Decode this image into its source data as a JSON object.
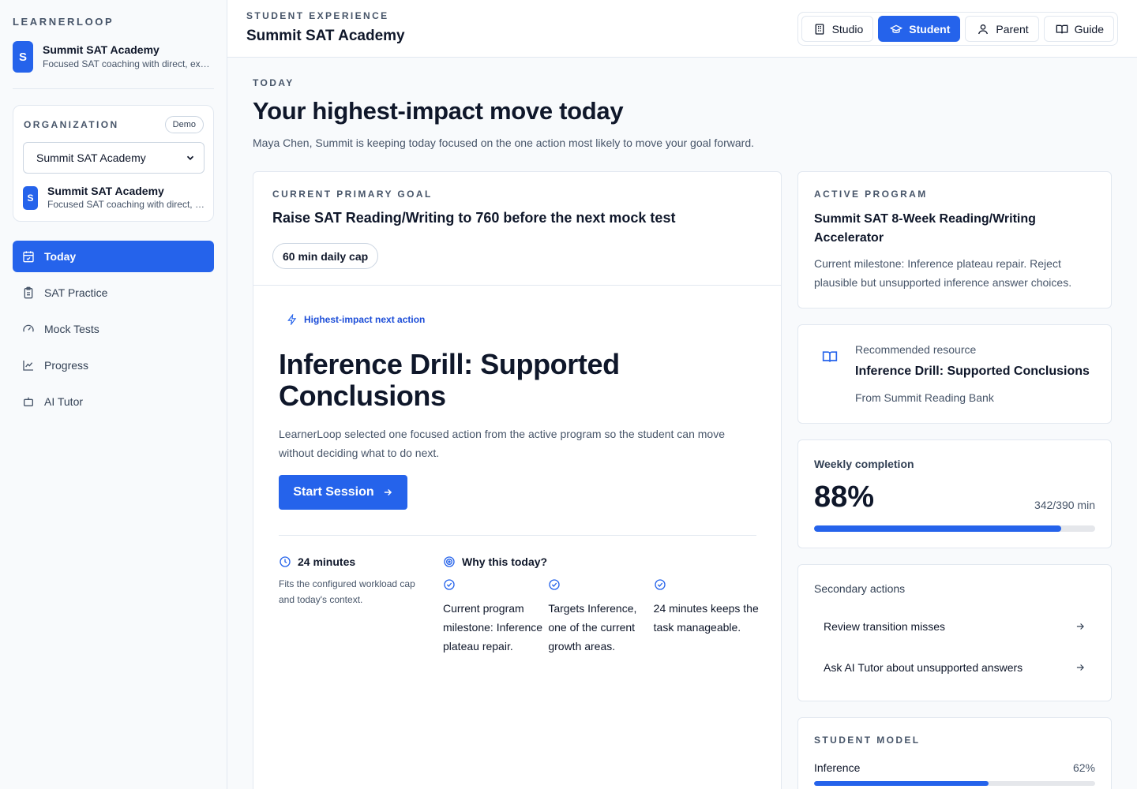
{
  "sidebar": {
    "brand": "LEARNERLOOP",
    "org": {
      "initial": "S",
      "name": "Summit SAT Academy",
      "subtitle": "Focused SAT coaching with direct, exam-specific feedback"
    },
    "org_card": {
      "label": "ORGANIZATION",
      "badge": "Demo",
      "select_value": "Summit SAT Academy",
      "initial": "S",
      "name": "Summit SAT Academy",
      "subtitle": "Focused SAT coaching with direct, exam-specific feedback"
    },
    "nav": [
      {
        "label": "Today",
        "icon": "calendar-icon",
        "active": true
      },
      {
        "label": "SAT Practice",
        "icon": "clipboard-icon"
      },
      {
        "label": "Mock Tests",
        "icon": "gauge-icon"
      },
      {
        "label": "Progress",
        "icon": "chart-line-icon"
      },
      {
        "label": "AI Tutor",
        "icon": "bot-icon"
      }
    ]
  },
  "topbar": {
    "kicker": "STUDENT EXPERIENCE",
    "title": "Summit SAT Academy",
    "modes": [
      {
        "label": "Studio",
        "icon": "building-icon"
      },
      {
        "label": "Student",
        "icon": "graduation-cap-icon",
        "active": true
      },
      {
        "label": "Parent",
        "icon": "user-icon"
      },
      {
        "label": "Guide",
        "icon": "book-open-icon"
      }
    ]
  },
  "main": {
    "kicker": "TODAY",
    "title": "Your highest-impact move today",
    "subtitle": "Maya Chen, Summit is keeping today focused on the one action most likely to move your goal forward.",
    "goal": {
      "label": "CURRENT PRIMARY GOAL",
      "text": "Raise SAT Reading/Writing to 760 before the next mock test",
      "cap": "60 min daily cap"
    },
    "action": {
      "tag": "Highest-impact next action",
      "title": "Inference Drill: Supported Conclusions",
      "description": "LearnerLoop selected one focused action from the active program so the student can move without deciding what to do next.",
      "button": "Start Session",
      "duration": "24 minutes",
      "duration_note": "Fits the configured workload cap and today's context.",
      "why_title": "Why this today?",
      "reasons": [
        "Current program milestone: Inference plateau repair.",
        "Targets Inference, one of the current growth areas.",
        "24 minutes keeps the task manageable."
      ]
    },
    "program": {
      "label": "ACTIVE PROGRAM",
      "title": "Summit SAT 8-Week Reading/Writing Accelerator",
      "description": "Current milestone: Inference plateau repair. Reject plausible but unsupported inference answer choices."
    },
    "resource": {
      "label": "Recommended resource",
      "title": "Inference Drill: Supported Conclusions",
      "from": "From Summit Reading Bank"
    },
    "weekly": {
      "label": "Weekly completion",
      "percent_text": "88%",
      "minutes": "342/390 min",
      "progress": 0.88
    },
    "secondary": {
      "label": "Secondary actions",
      "items": [
        "Review transition misses",
        "Ask AI Tutor about unsupported answers"
      ]
    },
    "model": {
      "label": "STUDENT MODEL",
      "skill": "Inference",
      "percent_text": "62%",
      "progress": 0.62
    }
  },
  "colors": {
    "accent": "#2563eb",
    "border": "#e2e8f0",
    "muted": "#475569"
  }
}
